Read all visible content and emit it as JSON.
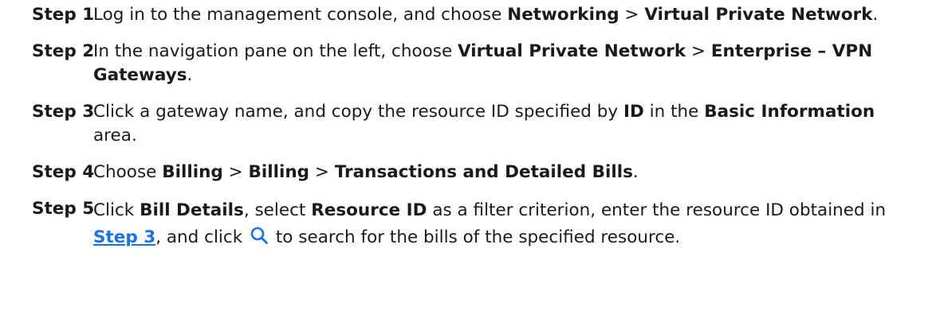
{
  "steps": [
    {
      "label": "Step 1",
      "parts": [
        {
          "t": "Log in to the management console, and choose "
        },
        {
          "b": "Networking"
        },
        {
          "t": " > "
        },
        {
          "b": "Virtual Private Network"
        },
        {
          "t": "."
        }
      ]
    },
    {
      "label": "Step 2",
      "parts": [
        {
          "t": "In the navigation pane on the left, choose "
        },
        {
          "b": "Virtual Private Network"
        },
        {
          "t": " > "
        },
        {
          "b": "Enterprise – VPN Gateways"
        },
        {
          "t": "."
        }
      ]
    },
    {
      "label": "Step 3",
      "parts": [
        {
          "t": "Click a gateway name, and copy the resource ID specified by "
        },
        {
          "b": "ID"
        },
        {
          "t": " in the "
        },
        {
          "b": "Basic Information"
        },
        {
          "t": " area."
        }
      ]
    },
    {
      "label": "Step 4",
      "parts": [
        {
          "t": "Choose "
        },
        {
          "b": "Billing"
        },
        {
          "t": " > "
        },
        {
          "b": "Billing"
        },
        {
          "t": " > "
        },
        {
          "b": "Transactions and Detailed Bills"
        },
        {
          "t": "."
        }
      ]
    },
    {
      "label": "Step 5",
      "parts": [
        {
          "t": "Click "
        },
        {
          "b": "Bill Details"
        },
        {
          "t": ", select "
        },
        {
          "b": "Resource ID"
        },
        {
          "t": " as a filter criterion, enter the resource ID obtained in "
        },
        {
          "link": "Step 3"
        },
        {
          "t": ", and click "
        },
        {
          "icon": "search-icon"
        },
        {
          "t": " to search for the bills of the specified resource."
        }
      ]
    }
  ],
  "colors": {
    "text": "#1a1a1a",
    "link": "#1a72e8",
    "icon": "#1a72e8"
  }
}
